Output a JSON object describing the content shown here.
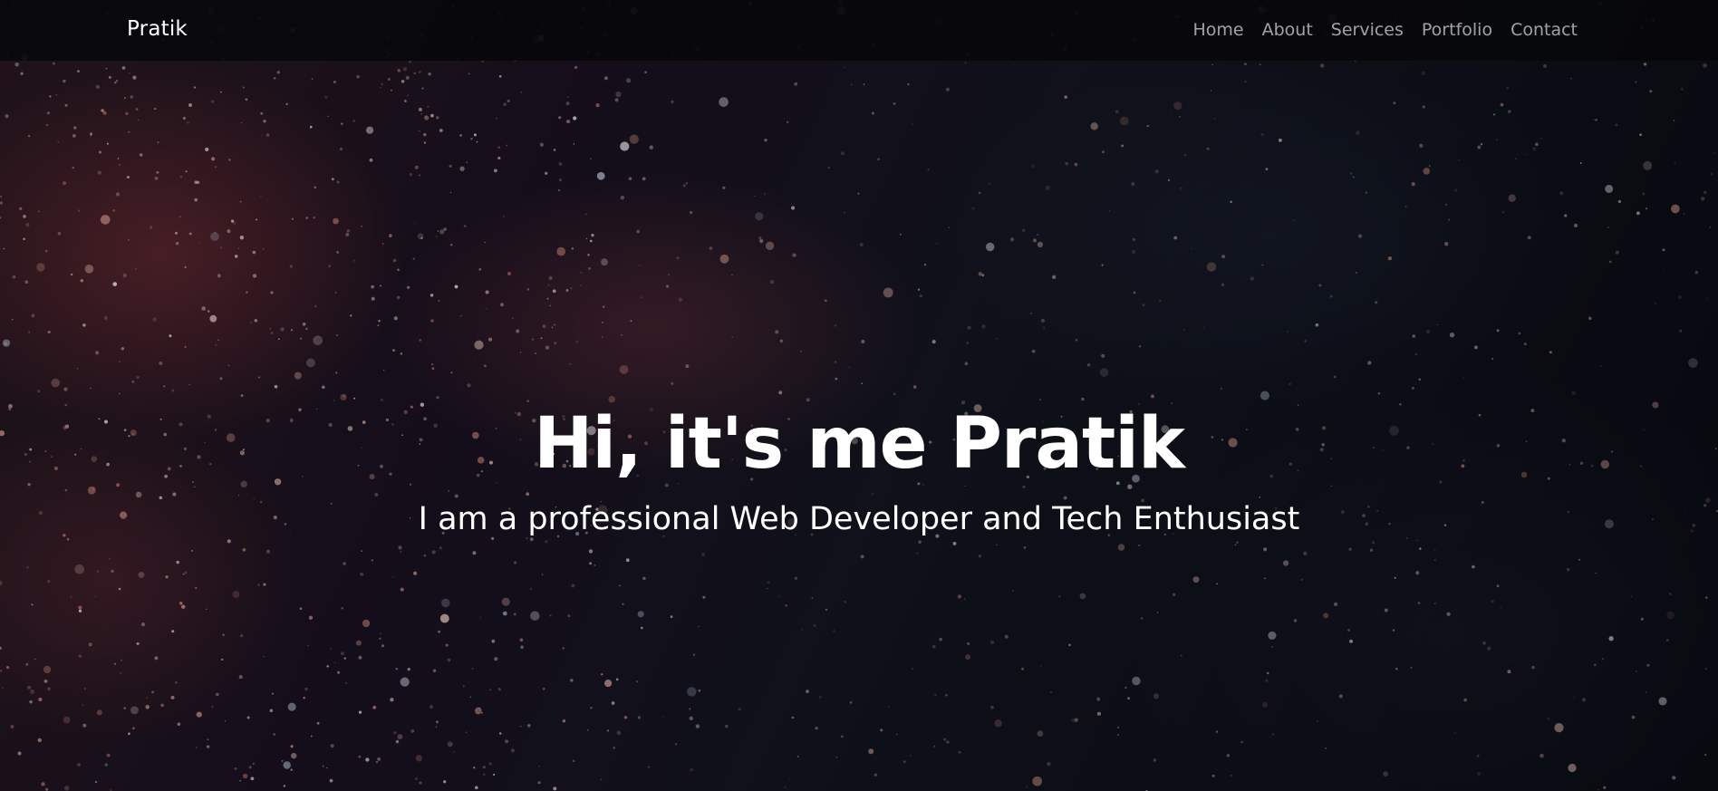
{
  "navbar": {
    "brand": "Pratik",
    "links": [
      {
        "label": "Home"
      },
      {
        "label": "About"
      },
      {
        "label": "Services"
      },
      {
        "label": "Portfolio"
      },
      {
        "label": "Contact"
      }
    ]
  },
  "hero": {
    "title": "Hi, it's me Pratik",
    "subtitle": "I am a professional Web Developer and Tech Enthusiast"
  },
  "colors": {
    "navbar_background": "#08080a",
    "text_primary": "#ffffff",
    "nav_link": "#9e9e9e"
  }
}
